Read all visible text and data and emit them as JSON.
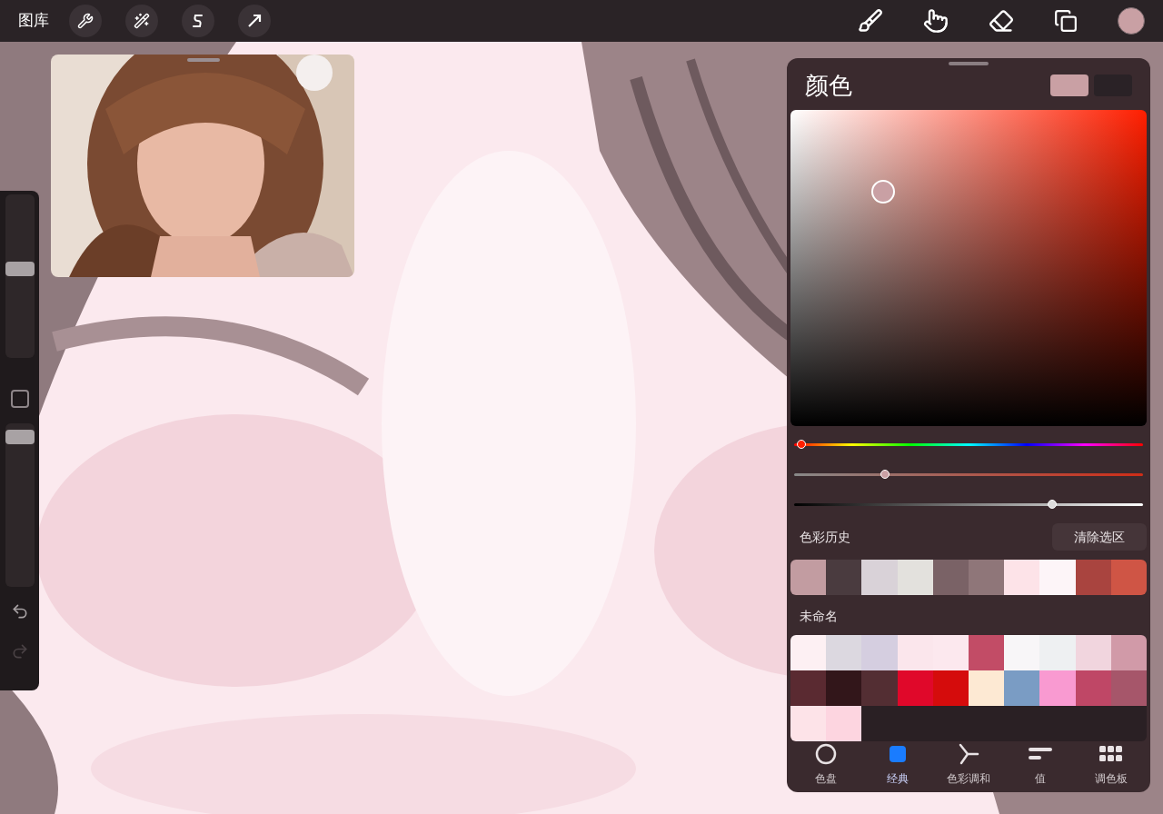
{
  "toolbar": {
    "gallery": "图库",
    "current_color": {
      "color": "#c9a0a4"
    }
  },
  "sidebar": {
    "brush_size": {
      "level": 0.55
    },
    "opacity": {
      "level": 0.96
    },
    "undo": {
      "disabled": false
    },
    "redo": {
      "disabled": true
    }
  },
  "color_panel": {
    "title": "颜色",
    "primary": {
      "color": "#c9a0a4"
    },
    "secondary": {
      "color": "#2a2226"
    },
    "hue": {
      "level": 0.02
    },
    "saturation": {
      "level": 0.26
    },
    "brightness": {
      "level": 0.74
    },
    "history": {
      "title": "色彩历史",
      "clear_button": "清除选区",
      "swatches": [
        {
          "color": "#c29ca1"
        },
        {
          "color": "#4a3b3f"
        },
        {
          "color": "#d9d2d8"
        },
        {
          "color": "#e3e1dd"
        },
        {
          "color": "#7a6266"
        },
        {
          "color": "#8f7679"
        },
        {
          "color": "#fde3e8"
        },
        {
          "color": "#fdf5f8"
        },
        {
          "color": "#a9443f"
        },
        {
          "color": "#cf5545"
        }
      ]
    },
    "palette": {
      "title": "未命名",
      "swatches": [
        {
          "color": "#fdf0f3"
        },
        {
          "color": "#dcd8e0"
        },
        {
          "color": "#d5cee0"
        },
        {
          "color": "#fbe6ec"
        },
        {
          "color": "#fce8ee"
        },
        {
          "color": "#c24c66"
        },
        {
          "color": "#f8f6f8"
        },
        {
          "color": "#eef0f2"
        },
        {
          "color": "#f1d5de"
        },
        {
          "color": "#d19aa8"
        },
        {
          "color": "#5a2a31"
        },
        {
          "color": "#32161a"
        },
        {
          "color": "#532e33"
        },
        {
          "color": "#e0082a"
        },
        {
          "color": "#d50c0c"
        },
        {
          "color": "#fde9d3"
        },
        {
          "color": "#7a9cc4"
        },
        {
          "color": "#f99ad1"
        },
        {
          "color": "#bf4766"
        },
        {
          "color": "#a6566a"
        },
        {
          "color": "#fde3e8"
        },
        {
          "color": "#fdd5e0"
        }
      ]
    },
    "tabs": [
      {
        "label": "色盘",
        "kind": "disc",
        "selected": false
      },
      {
        "label": "经典",
        "kind": "classic",
        "selected": true
      },
      {
        "label": "色彩调和",
        "kind": "harmony",
        "selected": false
      },
      {
        "label": "值",
        "kind": "value",
        "selected": false
      },
      {
        "label": "调色板",
        "kind": "palettes",
        "selected": false
      }
    ]
  }
}
